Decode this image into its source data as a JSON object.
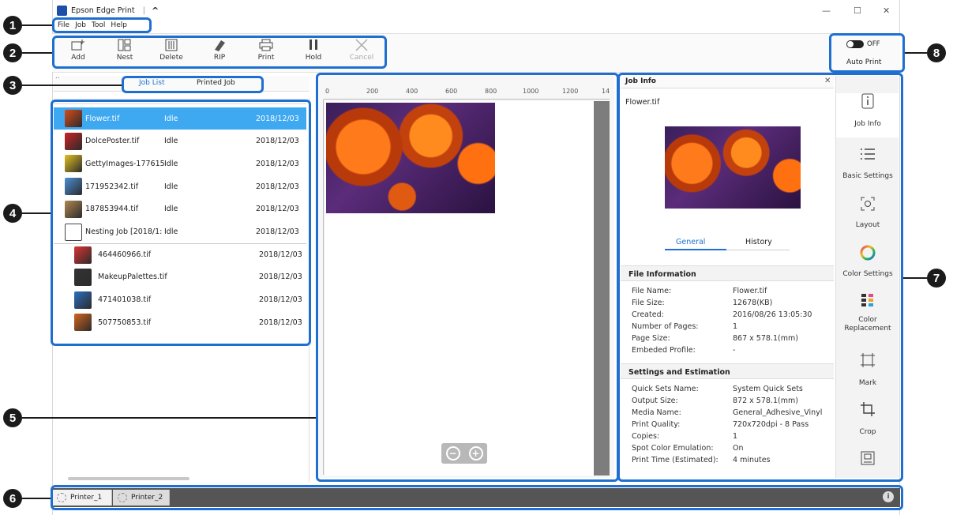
{
  "app": {
    "title": "Epson Edge Print"
  },
  "window_controls": {
    "minimize": "—",
    "maximize": "☐",
    "close": "✕"
  },
  "menu": [
    "File",
    "Job",
    "Tool",
    "Help"
  ],
  "toolbar": {
    "add": "Add",
    "nest": "Nest",
    "delete": "Delete",
    "rip": "RIP",
    "print": "Print",
    "hold": "Hold",
    "cancel": "Cancel"
  },
  "auto_print": {
    "toggle_state": "OFF",
    "label": "Auto Print"
  },
  "job_tabs": {
    "job_list": "Job List",
    "printed_job": "Printed Job"
  },
  "jobs": [
    {
      "name": "Flower.tif",
      "status": "Idle",
      "date": "2018/12/03"
    },
    {
      "name": "DolcePoster.tif",
      "status": "Idle",
      "date": "2018/12/03"
    },
    {
      "name": "GettyImages-177615",
      "status": "Idle",
      "date": "2018/12/03"
    },
    {
      "name": "171952342.tif",
      "status": "Idle",
      "date": "2018/12/03"
    },
    {
      "name": "187853944.tif",
      "status": "Idle",
      "date": "2018/12/03"
    },
    {
      "name": "Nesting Job [2018/1:",
      "status": "Idle",
      "date": "2018/12/03"
    },
    {
      "name": "464460966.tif",
      "status": "",
      "date": "2018/12/03"
    },
    {
      "name": "MakeupPalettes.tif",
      "status": "",
      "date": "2018/12/03"
    },
    {
      "name": "471401038.tif",
      "status": "",
      "date": "2018/12/03"
    },
    {
      "name": "507750853.tif",
      "status": "",
      "date": "2018/12/03"
    }
  ],
  "ruler": [
    "0",
    "200",
    "400",
    "600",
    "800",
    "1000",
    "1200",
    "14"
  ],
  "job_info": {
    "header": "Job Info",
    "file": "Flower.tif",
    "tabs": {
      "general": "General",
      "history": "History"
    },
    "file_information": {
      "title": "File Information",
      "rows": [
        {
          "k": "File Name:",
          "v": "Flower.tif"
        },
        {
          "k": "File Size:",
          "v": "12678(KB)"
        },
        {
          "k": "Created:",
          "v": "2016/08/26 13:05:30"
        },
        {
          "k": "Number of Pages:",
          "v": "1"
        },
        {
          "k": "Page Size:",
          "v": "867 x 578.1(mm)"
        },
        {
          "k": "Embeded Profile:",
          "v": "-"
        }
      ]
    },
    "settings": {
      "title": "Settings and Estimation",
      "rows": [
        {
          "k": "Quick Sets Name:",
          "v": "System Quick Sets"
        },
        {
          "k": "Output Size:",
          "v": "872 x 578.1(mm)"
        },
        {
          "k": "Media Name:",
          "v": "General_Adhesive_Vinyl"
        },
        {
          "k": "Print Quality:",
          "v": "720x720dpi - 8 Pass"
        },
        {
          "k": "Copies:",
          "v": "1"
        },
        {
          "k": "Spot Color Emulation:",
          "v": "On"
        },
        {
          "k": "Print Time (Estimated):",
          "v": "4 minutes"
        }
      ]
    }
  },
  "side_menu": [
    "Job Info",
    "Basic Settings",
    "Layout",
    "Color Settings",
    "Color Replacement",
    "Mark",
    "Crop"
  ],
  "printers": [
    "Printer_1",
    "Printer_2"
  ],
  "callouts": [
    "1",
    "2",
    "3",
    "4",
    "5",
    "6",
    "7",
    "8"
  ],
  "colors": {
    "accent": "#1e6fd0",
    "selection": "#3ea8f0",
    "statusbar": "#555555"
  }
}
